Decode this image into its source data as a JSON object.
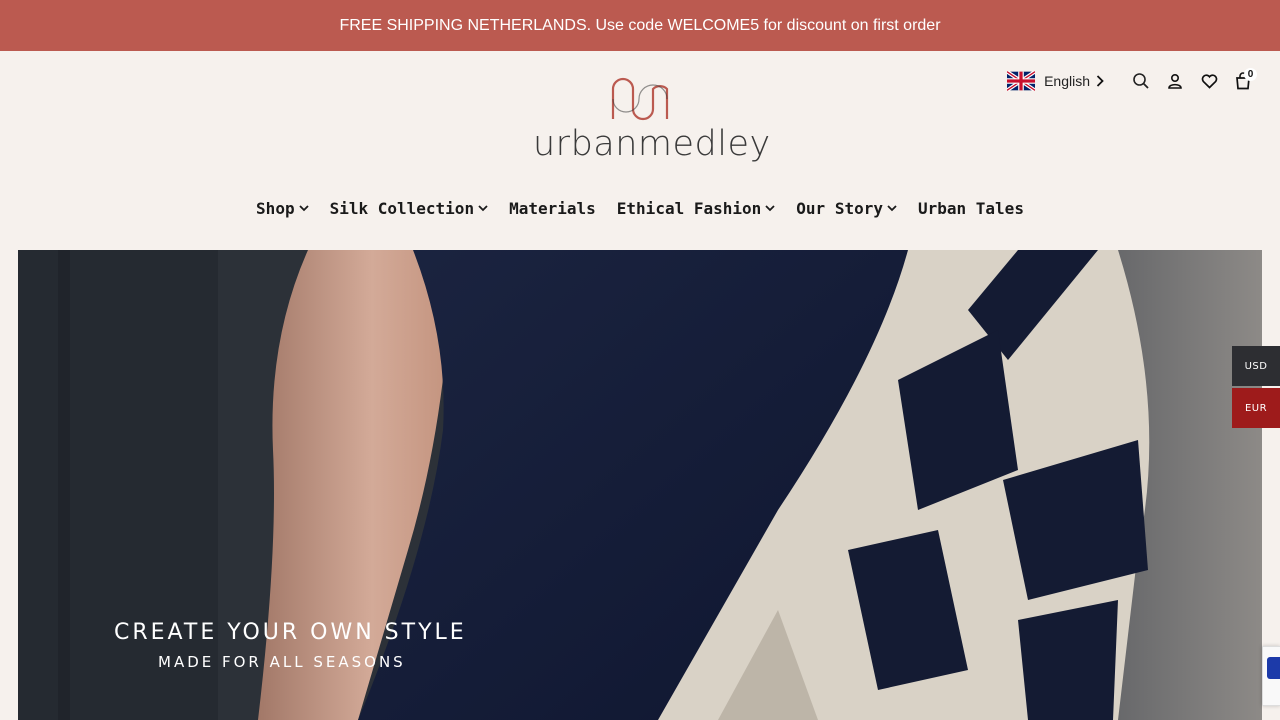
{
  "announcement": "FREE SHIPPING NETHERLANDS. Use code WELCOME5 for discount on first order",
  "brand": {
    "name": "urbanmedley",
    "logo_color": "#bb5a50"
  },
  "header_tools": {
    "language": "English",
    "icons": [
      "uk-flag-icon",
      "chevron-right-icon",
      "search-icon",
      "user-icon",
      "heart-icon",
      "cart-icon"
    ],
    "cart_count": "0"
  },
  "nav": [
    {
      "label": "Shop",
      "dropdown": true
    },
    {
      "label": "Silk Collection",
      "dropdown": true
    },
    {
      "label": "Materials",
      "dropdown": false
    },
    {
      "label": "Ethical Fashion",
      "dropdown": true
    },
    {
      "label": "Our Story",
      "dropdown": true
    },
    {
      "label": "Urban Tales",
      "dropdown": false
    }
  ],
  "hero": {
    "title": "CREATE YOUR OWN STYLE",
    "subtitle": "MADE FOR ALL SEASONS"
  },
  "currency": {
    "usd": "USD",
    "eur": "EUR",
    "active_color": "#9e1b1b"
  },
  "colors": {
    "announce_bg": "#bb5a50",
    "page_bg": "#f6f1ed"
  }
}
